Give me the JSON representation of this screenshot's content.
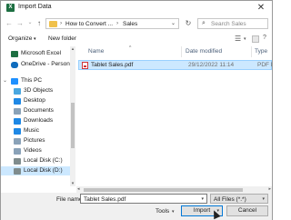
{
  "window": {
    "title": "Import Data",
    "close_glyph": "✕"
  },
  "address_bar": {
    "crumbs": [
      "How to Convert ...",
      "Sales"
    ],
    "search_placeholder": "Search Sales"
  },
  "toolbar": {
    "organize_label": "Organize",
    "new_folder_label": "New folder"
  },
  "sidebar": {
    "items": [
      {
        "label": "Microsoft Excel",
        "icon": "excel-icon",
        "color": "#1d6f42"
      },
      {
        "label": "OneDrive - Person",
        "icon": "onedrive-icon",
        "color": "#0f6cbd"
      },
      {
        "label": "This PC",
        "icon": "pc-icon",
        "color": "#1e90ff"
      },
      {
        "label": "3D Objects",
        "icon": "3d-objects-icon",
        "color": "#49a7e0"
      },
      {
        "label": "Desktop",
        "icon": "desktop-icon",
        "color": "#1e88e5"
      },
      {
        "label": "Documents",
        "icon": "documents-icon",
        "color": "#8aa2b8"
      },
      {
        "label": "Downloads",
        "icon": "downloads-icon",
        "color": "#1e88e5"
      },
      {
        "label": "Music",
        "icon": "music-icon",
        "color": "#1e88e5"
      },
      {
        "label": "Pictures",
        "icon": "pictures-icon",
        "color": "#8aa2b8"
      },
      {
        "label": "Videos",
        "icon": "videos-icon",
        "color": "#8aa2b8"
      },
      {
        "label": "Local Disk (C:)",
        "icon": "disk-icon",
        "color": "#7f8c8d"
      },
      {
        "label": "Local Disk (D:)",
        "icon": "disk-icon",
        "color": "#7f8c8d",
        "selected": true
      }
    ]
  },
  "file_list": {
    "columns": [
      "Name",
      "Date modified",
      "Type"
    ],
    "rows": [
      {
        "name": "Tablet Sales.pdf",
        "date": "29/12/2022 11:14",
        "type": "PDF Document",
        "selected": true
      }
    ]
  },
  "footer": {
    "file_name_label": "File name:",
    "file_name_value": "Tablet Sales.pdf",
    "filter_value": "All Files (*.*)",
    "tools_label": "Tools",
    "import_label": "Import",
    "cancel_label": "Cancel"
  }
}
